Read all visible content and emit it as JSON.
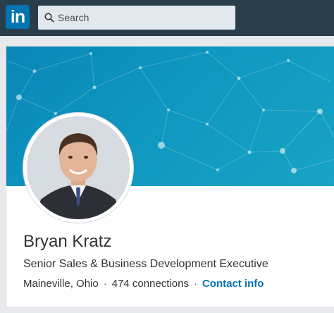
{
  "nav": {
    "logo_text": "in",
    "search_placeholder": "Search",
    "background": "#283e4a",
    "logo_color": "#0073b1"
  },
  "profile": {
    "name": "Bryan Kratz",
    "headline": "Senior Sales & Business Development Executive",
    "location": "Maineville, Ohio",
    "separator": "·",
    "connections": "474 connections",
    "contact_link": "Contact info",
    "link_color": "#0073b1",
    "banner_color": "#0e97c0"
  }
}
